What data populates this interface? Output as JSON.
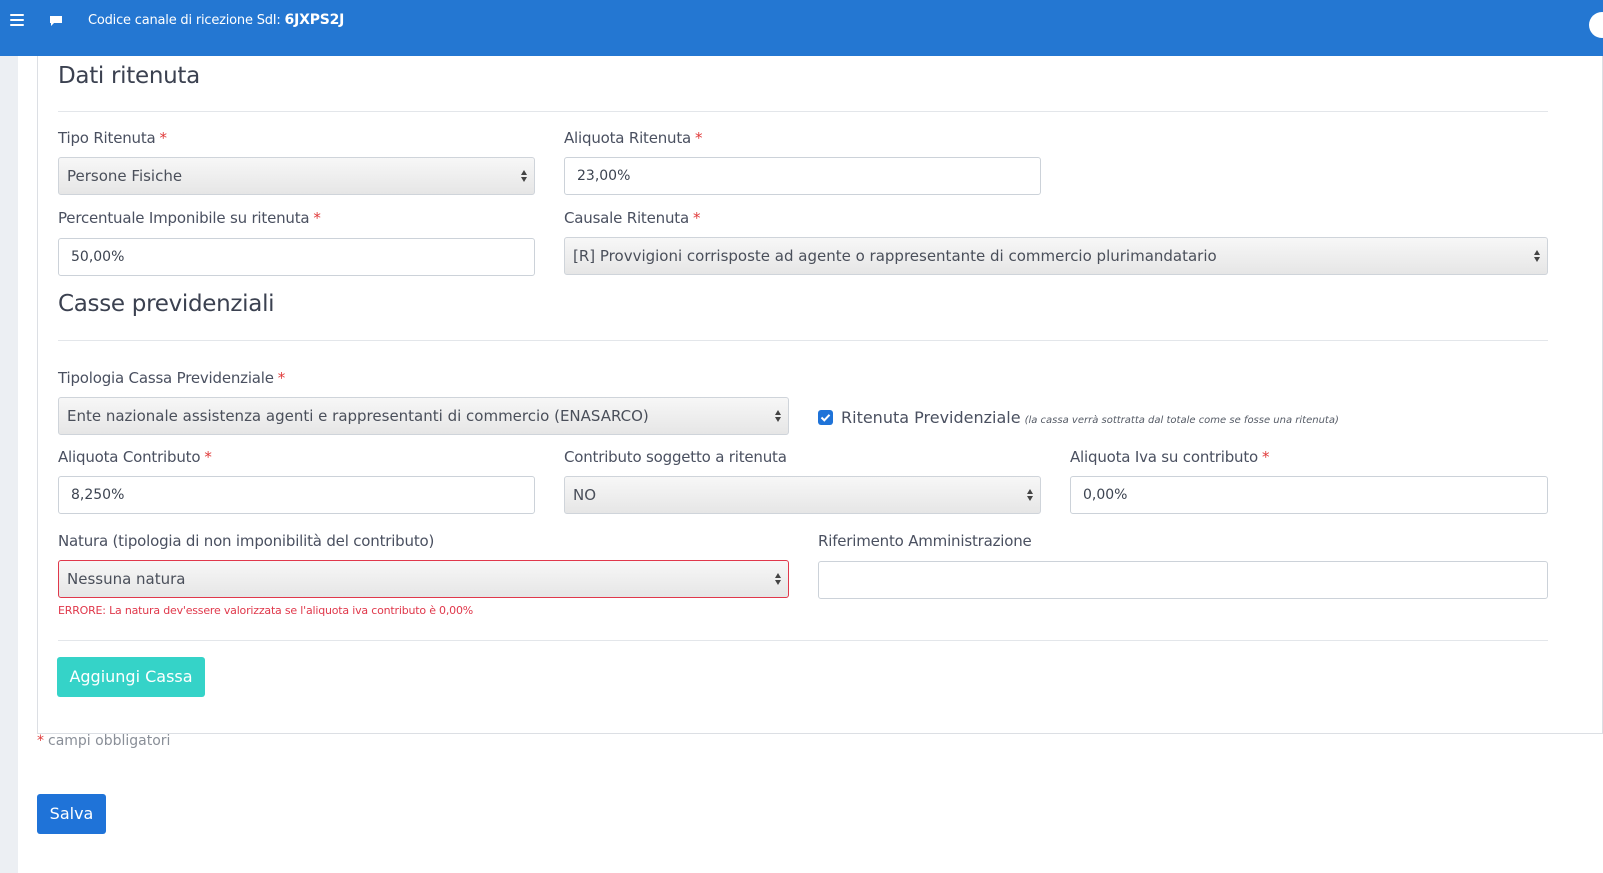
{
  "topbar": {
    "sdi_label": "Codice canale di ricezione SdI:",
    "sdi_code": "6JXPS2J"
  },
  "ritenuta": {
    "title": "Dati ritenuta",
    "tipo_label": "Tipo Ritenuta",
    "tipo_value": "Persone Fisiche",
    "aliquota_label": "Aliquota Ritenuta",
    "aliquota_value": "23,00%",
    "percentuale_label": "Percentuale Imponibile su ritenuta",
    "percentuale_value": "50,00%",
    "causale_label": "Causale Ritenuta",
    "causale_value": "[R] Provvigioni corrisposte ad agente o rappresentante di commercio plurimandatario"
  },
  "casse": {
    "title": "Casse previdenziali",
    "tipologia_label": "Tipologia Cassa Previdenziale",
    "tipologia_value": "Ente nazionale assistenza agenti e rappresentanti di commercio (ENASARCO)",
    "ritenuta_prev_label": "Ritenuta Previdenziale",
    "ritenuta_prev_note": "(la cassa verrà sottratta dal totale come se fosse una ritenuta)",
    "ritenuta_prev_checked": true,
    "aliquota_contributo_label": "Aliquota Contributo",
    "aliquota_contributo_value": "8,250%",
    "contributo_soggetto_label": "Contributo soggetto a ritenuta",
    "contributo_soggetto_value": "NO",
    "aliquota_iva_label": "Aliquota Iva su contributo",
    "aliquota_iva_value": "0,00%",
    "natura_label": "Natura (tipologia di non imponibilità del contributo)",
    "natura_value": "Nessuna natura",
    "natura_error": "ERRORE: La natura dev'essere valorizzata se l'aliquota iva contributo è 0,00%",
    "riferimento_label": "Riferimento Amministrazione",
    "riferimento_value": "",
    "add_button": "Aggiungi Cassa"
  },
  "footer": {
    "required_star": "*",
    "required_note": "campi obbligatori",
    "save_button": "Salva"
  },
  "colors": {
    "topbar": "#2477d2",
    "primary": "#1f73d8",
    "teal": "#35d3c8",
    "error": "#e0384b"
  }
}
